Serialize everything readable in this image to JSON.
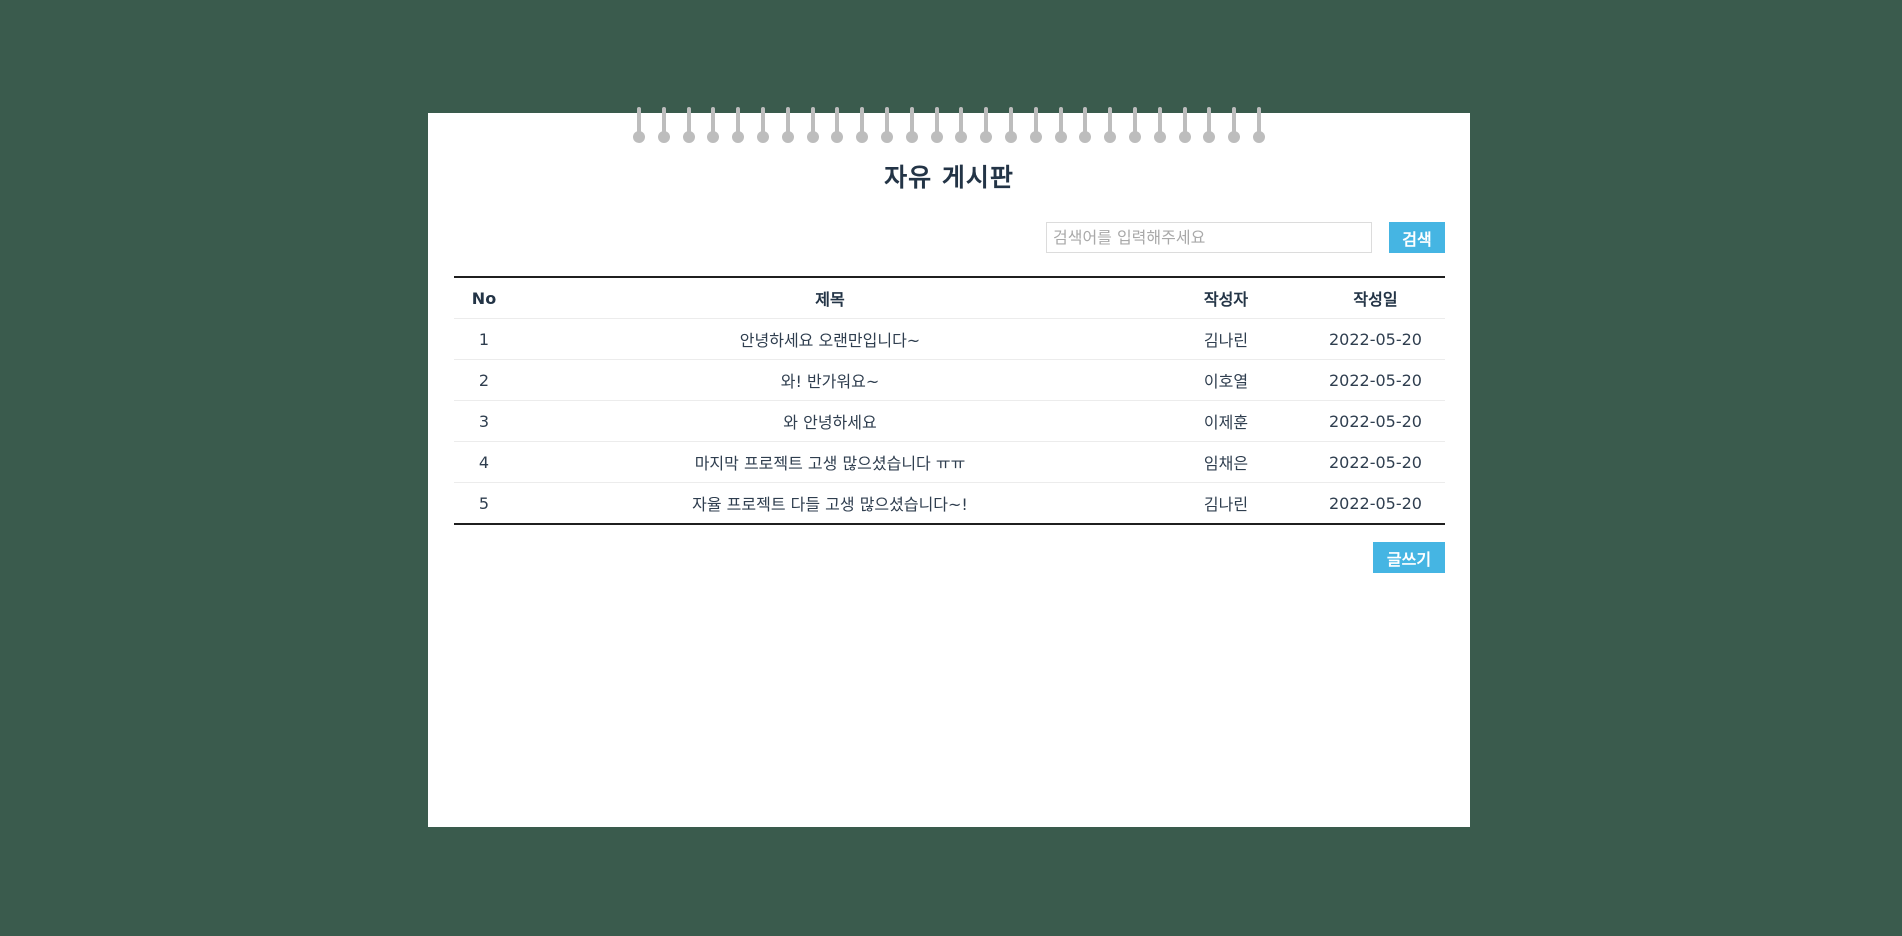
{
  "board": {
    "title": "자유 게시판",
    "ring_count": 26
  },
  "search": {
    "placeholder": "검색어를 입력해주세요",
    "value": "",
    "button_label": "검색"
  },
  "table": {
    "headers": {
      "no": "No",
      "title": "제목",
      "writer": "작성자",
      "date": "작성일"
    },
    "rows": [
      {
        "no": "1",
        "title": "안녕하세요 오랜만입니다~",
        "writer": "김나린",
        "date": "2022-05-20"
      },
      {
        "no": "2",
        "title": "와! 반가워요~",
        "writer": "이호열",
        "date": "2022-05-20"
      },
      {
        "no": "3",
        "title": "와 안녕하세요",
        "writer": "이제훈",
        "date": "2022-05-20"
      },
      {
        "no": "4",
        "title": "마지막 프로젝트 고생 많으셨습니다 ㅠㅠ",
        "writer": "임채은",
        "date": "2022-05-20"
      },
      {
        "no": "5",
        "title": "자율 프로젝트 다들 고생 많으셨습니다~!",
        "writer": "김나린",
        "date": "2022-05-20"
      }
    ]
  },
  "actions": {
    "write_label": "글쓰기"
  },
  "colors": {
    "background": "#3a5b4d",
    "accent": "#45b5e3",
    "title_text": "#233446"
  }
}
